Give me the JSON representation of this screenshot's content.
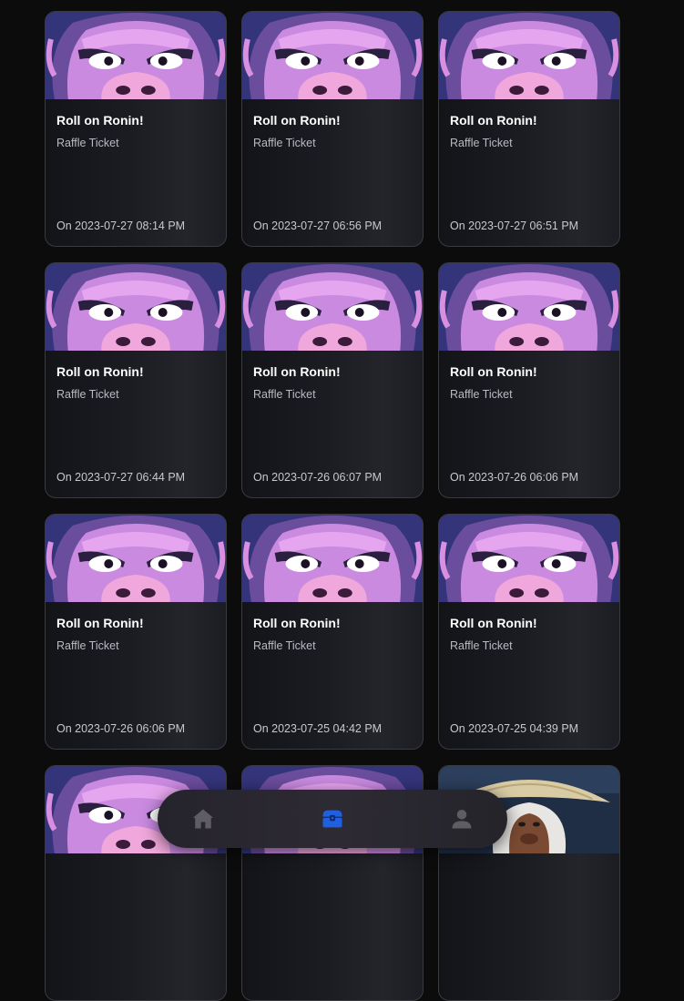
{
  "cards": [
    {
      "title": "Roll on Ronin!",
      "subtitle": "Raffle Ticket",
      "date": "On 2023-07-27 08:14 PM",
      "image": "gorilla"
    },
    {
      "title": "Roll on Ronin!",
      "subtitle": "Raffle Ticket",
      "date": "On 2023-07-27 06:56 PM",
      "image": "gorilla"
    },
    {
      "title": "Roll on Ronin!",
      "subtitle": "Raffle Ticket",
      "date": "On 2023-07-27 06:51 PM",
      "image": "gorilla"
    },
    {
      "title": "Roll on Ronin!",
      "subtitle": "Raffle Ticket",
      "date": "On 2023-07-27 06:44 PM",
      "image": "gorilla"
    },
    {
      "title": "Roll on Ronin!",
      "subtitle": "Raffle Ticket",
      "date": "On 2023-07-26 06:07 PM",
      "image": "gorilla"
    },
    {
      "title": "Roll on Ronin!",
      "subtitle": "Raffle Ticket",
      "date": "On 2023-07-26 06:06 PM",
      "image": "gorilla"
    },
    {
      "title": "Roll on Ronin!",
      "subtitle": "Raffle Ticket",
      "date": "On 2023-07-26 06:06 PM",
      "image": "gorilla"
    },
    {
      "title": "Roll on Ronin!",
      "subtitle": "Raffle Ticket",
      "date": "On 2023-07-25 04:42 PM",
      "image": "gorilla"
    },
    {
      "title": "Roll on Ronin!",
      "subtitle": "Raffle Ticket",
      "date": "On 2023-07-25 04:39 PM",
      "image": "gorilla"
    },
    {
      "title": "",
      "subtitle": "",
      "date": "",
      "image": "gorilla"
    },
    {
      "title": "",
      "subtitle": "",
      "date": "",
      "image": "gorilla"
    },
    {
      "title": "",
      "subtitle": "",
      "date": "",
      "image": "ronin-monkey"
    }
  ],
  "nav": {
    "items": [
      {
        "icon": "home-icon",
        "active": false
      },
      {
        "icon": "treasure-chest-icon",
        "active": true
      },
      {
        "icon": "user-icon",
        "active": false
      }
    ],
    "active_color": "#1f5fe0",
    "inactive_color": "#5e5d64"
  },
  "colors": {
    "background": "#0c0c0d",
    "gorilla_fur": "#3a3a82",
    "gorilla_face": "#c98ae0",
    "gorilla_nose": "#f0a8dc"
  }
}
